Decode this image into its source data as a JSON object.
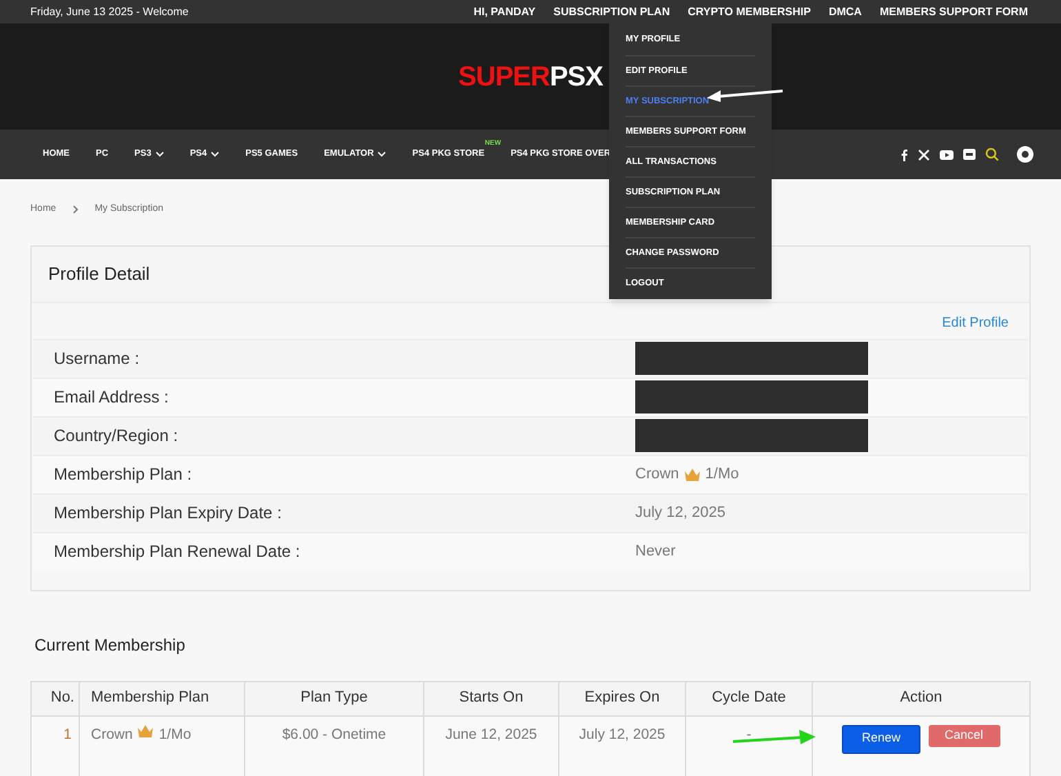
{
  "top_bar": {
    "welcome": "Friday, June 13 2025 - Welcome",
    "links": [
      "HI, PANDAY",
      "SUBSCRIPTION PLAN",
      "CRYPTO MEMBERSHIP",
      "DMCA",
      "MEMBERS SUPPORT FORM"
    ]
  },
  "logo": {
    "first": "SUPER",
    "second": "PSX"
  },
  "nav": {
    "items": [
      {
        "label": "HOME",
        "dropdown": false
      },
      {
        "label": "PC",
        "dropdown": false
      },
      {
        "label": "PS3",
        "dropdown": true
      },
      {
        "label": "PS4",
        "dropdown": true
      },
      {
        "label": "PS5 GAMES",
        "dropdown": false
      },
      {
        "label": "EMULATOR",
        "dropdown": true
      },
      {
        "label": "PS4 PKG STORE",
        "dropdown": false,
        "badge": "NEW"
      },
      {
        "label": "PS4 PKG STORE OVER",
        "dropdown": false
      }
    ]
  },
  "user_menu": [
    {
      "label": "MY PROFILE",
      "selected": false
    },
    {
      "label": "EDIT PROFILE",
      "selected": false
    },
    {
      "label": "MY SUBSCRIPTION",
      "selected": true
    },
    {
      "label": "MEMBERS SUPPORT FORM",
      "selected": false
    },
    {
      "label": "ALL TRANSACTIONS",
      "selected": false
    },
    {
      "label": "SUBSCRIPTION PLAN",
      "selected": false
    },
    {
      "label": "MEMBERSHIP CARD",
      "selected": false
    },
    {
      "label": "CHANGE PASSWORD",
      "selected": false
    },
    {
      "label": "LOGOUT",
      "selected": false
    }
  ],
  "breadcrumb": [
    "Home",
    "My Subscription"
  ],
  "profile": {
    "title": "Profile Detail",
    "edit_link": "Edit Profile",
    "fields": [
      {
        "label": "Username :",
        "kind": "redacted"
      },
      {
        "label": "Email Address :",
        "kind": "redacted"
      },
      {
        "label": "Country/Region :",
        "kind": "redacted"
      },
      {
        "label": "Membership Plan :",
        "kind": "plan",
        "name": "Crown",
        "period": "1/Mo"
      },
      {
        "label": "Membership Plan Expiry Date :",
        "kind": "text",
        "value": "July 12, 2025"
      },
      {
        "label": "Membership Plan Renewal Date :",
        "kind": "text",
        "value": "Never"
      }
    ]
  },
  "membership": {
    "title": "Current Membership",
    "columns": [
      "No.",
      "Membership Plan",
      "Plan Type",
      "Starts On",
      "Expires On",
      "Cycle Date",
      "Action"
    ],
    "rows": [
      {
        "no": "1",
        "plan_name": "Crown",
        "plan_period": "1/Mo",
        "plan_type": "$6.00 - Onetime",
        "starts_on": "June 12, 2025",
        "expires_on": "July 12, 2025",
        "cycle_date": "-",
        "actions": [
          {
            "label": "Renew",
            "kind": "primary"
          },
          {
            "label": "Cancel",
            "kind": "danger"
          }
        ]
      }
    ]
  }
}
